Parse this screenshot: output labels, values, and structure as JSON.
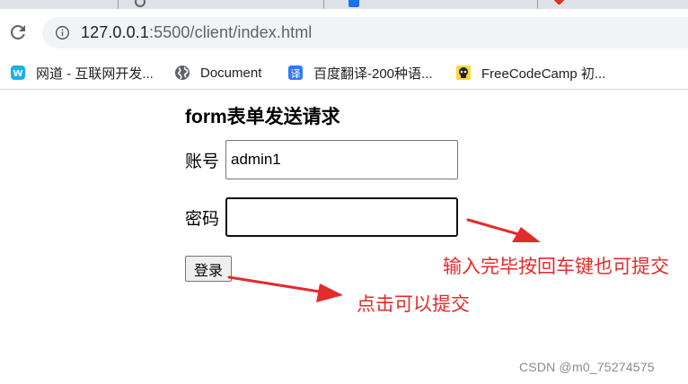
{
  "browser": {
    "url_prefix": "127.0.0.",
    "url_host": "1",
    "url_rest": ":5500/client/index.html",
    "bookmarks": [
      {
        "label": "网道 - 互联网开发...",
        "icon": "wangdao-icon"
      },
      {
        "label": "Document",
        "icon": "globe-icon"
      },
      {
        "label": "百度翻译-200种语...",
        "icon": "baidu-translate-icon"
      },
      {
        "label": "FreeCodeCamp 初...",
        "icon": "pirate-skull-icon"
      }
    ]
  },
  "form": {
    "title": "form表单发送请求",
    "account_label": "账号",
    "account_value": "admin1",
    "password_label": "密码",
    "password_value": "",
    "submit_label": "登录"
  },
  "annotations": {
    "enter_note": "输入完毕按回车键也可提交",
    "click_note": "点击可以提交",
    "color": "#e32b2b"
  },
  "watermark": "CSDN @m0_75274575"
}
